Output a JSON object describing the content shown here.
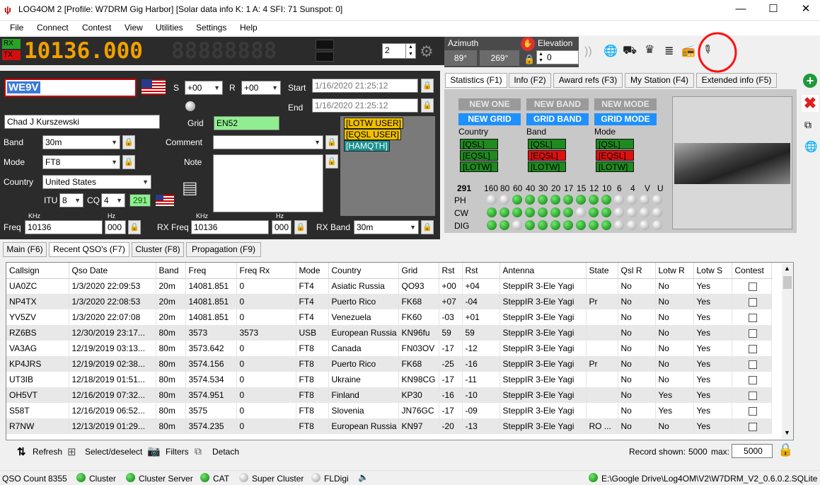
{
  "title": "LOG4OM 2 [Profile: W7DRM Gig Harbor] [Solar data info K: 1 A: 4 SFI: 71 Sunspot: 0]",
  "menu": [
    "File",
    "Connect",
    "Contest",
    "View",
    "Utilities",
    "Settings",
    "Help"
  ],
  "vfo": {
    "rx": "RX",
    "tx": "TX",
    "freq_a": "10136.000",
    "freq_b": "88888888"
  },
  "spinner": "2",
  "rotor": {
    "azimuth_label": "Azimuth",
    "elevation_label": "Elevation",
    "az1": "89°",
    "az2": "269°",
    "elev": "0"
  },
  "qso": {
    "callsign": "WE9V",
    "s_label": "S",
    "s_val": "+00",
    "r_label": "R",
    "r_val": "+00",
    "start_label": "Start",
    "start_val": "1/16/2020 21:25:12",
    "end_label": "End",
    "end_val": "1/16/2020 21:25:12",
    "name": "Chad J Kurszewski",
    "grid_label": "Grid",
    "grid": "EN52",
    "band_label": "Band",
    "band": "30m",
    "mode_label": "Mode",
    "mode": "FT8",
    "country_label": "Country",
    "country": "United States",
    "comment_label": "Comment",
    "note_label": "Note",
    "itu_label": "ITU",
    "itu": "8",
    "cq_label": "CQ",
    "cq": "4",
    "dxcc": "291",
    "khz": "KHz",
    "hz": "Hz",
    "freq_label": "Freq",
    "freq": "10136",
    "freq_hz": "000",
    "rxfreq_label": "RX Freq",
    "rxfreq": "10136",
    "rxfreq_hz": "000",
    "rxband_label": "RX Band",
    "rxband": "30m"
  },
  "user_tags": [
    "[LOTW USER]",
    "[EQSL USER]",
    "[HAMQTH]"
  ],
  "stat_tabs": [
    "Statistics (F1)",
    "Info (F2)",
    "Award refs (F3)",
    "My Station (F4)",
    "Extended info (F5)"
  ],
  "stats": {
    "row1": [
      "NEW ONE",
      "NEW BAND",
      "NEW MODE"
    ],
    "row2": [
      "NEW GRID",
      "GRID BAND",
      "GRID MODE"
    ],
    "col_headers": [
      "Country",
      "Band",
      "Mode"
    ],
    "country_tags": [
      "[QSL]",
      "[EQSL]",
      "[LOTW]"
    ],
    "band_tags": [
      "[QSL]",
      "[EQSL]",
      "[LOTW]"
    ],
    "mode_tags": [
      "[QSL]",
      "[EQSL]",
      "[LOTW]"
    ],
    "dxcc": "291",
    "bands": [
      "160",
      "80",
      "60",
      "40",
      "30",
      "20",
      "17",
      "15",
      "12",
      "10",
      "6",
      "4",
      "V",
      "U"
    ],
    "row_labels": [
      "PH",
      "CW",
      "DIG"
    ],
    "ph": [
      0,
      0,
      1,
      1,
      1,
      1,
      1,
      1,
      1,
      1,
      0,
      0,
      0,
      0
    ],
    "cw": [
      1,
      1,
      1,
      1,
      1,
      1,
      1,
      0,
      1,
      1,
      0,
      0,
      0,
      0
    ],
    "dig": [
      1,
      1,
      0,
      1,
      1,
      1,
      1,
      1,
      1,
      1,
      0,
      0,
      0,
      0
    ]
  },
  "main_tabs": [
    "Main (F6)",
    "Recent QSO's (F7)",
    "Cluster (F8)",
    "Propagation (F9)"
  ],
  "table": {
    "headers": [
      "Callsign",
      "Qso Date",
      "Band",
      "Freq",
      "Freq Rx",
      "Mode",
      "Country",
      "Grid",
      "Rst",
      "Rst",
      "Antenna",
      "State",
      "Qsl R",
      "Lotw R",
      "Lotw S",
      "Contest"
    ],
    "rows": [
      [
        "UA0ZC",
        "1/3/2020 22:09:53",
        "20m",
        "14081.851",
        "0",
        "FT4",
        "Asiatic Russia",
        "QO93",
        "+00",
        "+04",
        "SteppIR 3-Ele Yagi",
        "",
        "No",
        "No",
        "Yes"
      ],
      [
        "NP4TX",
        "1/3/2020 22:08:53",
        "20m",
        "14081.851",
        "0",
        "FT4",
        "Puerto Rico",
        "FK68",
        "+07",
        "-04",
        "SteppIR 3-Ele Yagi",
        "Pr",
        "No",
        "No",
        "Yes"
      ],
      [
        "YV5ZV",
        "1/3/2020 22:07:08",
        "20m",
        "14081.851",
        "0",
        "FT4",
        "Venezuela",
        "FK60",
        "-03",
        "+01",
        "SteppIR 3-Ele Yagi",
        "",
        "No",
        "No",
        "Yes"
      ],
      [
        "RZ6BS",
        "12/30/2019 23:17...",
        "80m",
        "3573",
        "3573",
        "USB",
        "European Russia",
        "KN96fu",
        "59",
        "59",
        "SteppIR 3-Ele Yagi",
        "",
        "No",
        "No",
        "Yes"
      ],
      [
        "VA3AG",
        "12/19/2019 03:13...",
        "80m",
        "3573.642",
        "0",
        "FT8",
        "Canada",
        "FN03OV",
        "-17",
        "-12",
        "SteppIR 3-Ele Yagi",
        "",
        "No",
        "No",
        "Yes"
      ],
      [
        "KP4JRS",
        "12/19/2019 02:38...",
        "80m",
        "3574.156",
        "0",
        "FT8",
        "Puerto Rico",
        "FK68",
        "-25",
        "-16",
        "SteppIR 3-Ele Yagi",
        "Pr",
        "No",
        "No",
        "Yes"
      ],
      [
        "UT3IB",
        "12/18/2019 01:51...",
        "80m",
        "3574.534",
        "0",
        "FT8",
        "Ukraine",
        "KN98CG",
        "-17",
        "-11",
        "SteppIR 3-Ele Yagi",
        "",
        "No",
        "No",
        "Yes"
      ],
      [
        "OH5VT",
        "12/16/2019 07:32...",
        "80m",
        "3574.951",
        "0",
        "FT8",
        "Finland",
        "KP30",
        "-16",
        "-10",
        "SteppIR 3-Ele Yagi",
        "",
        "No",
        "Yes",
        "Yes"
      ],
      [
        "S58T",
        "12/16/2019 06:52...",
        "80m",
        "3575",
        "0",
        "FT8",
        "Slovenia",
        "JN76GC",
        "-17",
        "-09",
        "SteppIR 3-Ele Yagi",
        "",
        "No",
        "Yes",
        "Yes"
      ],
      [
        "R7NW",
        "12/13/2019 01:29...",
        "80m",
        "3574.235",
        "0",
        "FT8",
        "European Russia",
        "KN97",
        "-20",
        "-13",
        "SteppIR 3-Ele Yagi",
        "RO ...",
        "No",
        "No",
        "Yes"
      ]
    ]
  },
  "bottom": {
    "refresh": "Refresh",
    "select": "Select/deselect",
    "filters": "Filters",
    "detach": "Detach",
    "record_label": "Record shown:",
    "record": "5000",
    "max_label": "max:",
    "max": "5000"
  },
  "status": {
    "qso_count_label": "QSO Count",
    "qso_count": "8355",
    "cluster": "Cluster",
    "cluster_server": "Cluster Server",
    "cat": "CAT",
    "super_cluster": "Super Cluster",
    "fldigi": "FLDigi",
    "db": "E:\\Google Drive\\Log4OM\\V2\\W7DRM_V2_0.6.0.2.SQLite"
  },
  "colors": {
    "vfo_digits": "#f0a000",
    "rx": "#27a327",
    "tx": "#d01010",
    "blue_badge": "#1e90ff",
    "tag_green": "#1f8a1f",
    "tag_red": "#e01010",
    "user_tag": "#f0c000",
    "hamqth_tag": "#1a9090",
    "grid_bg": "#90ee90"
  }
}
